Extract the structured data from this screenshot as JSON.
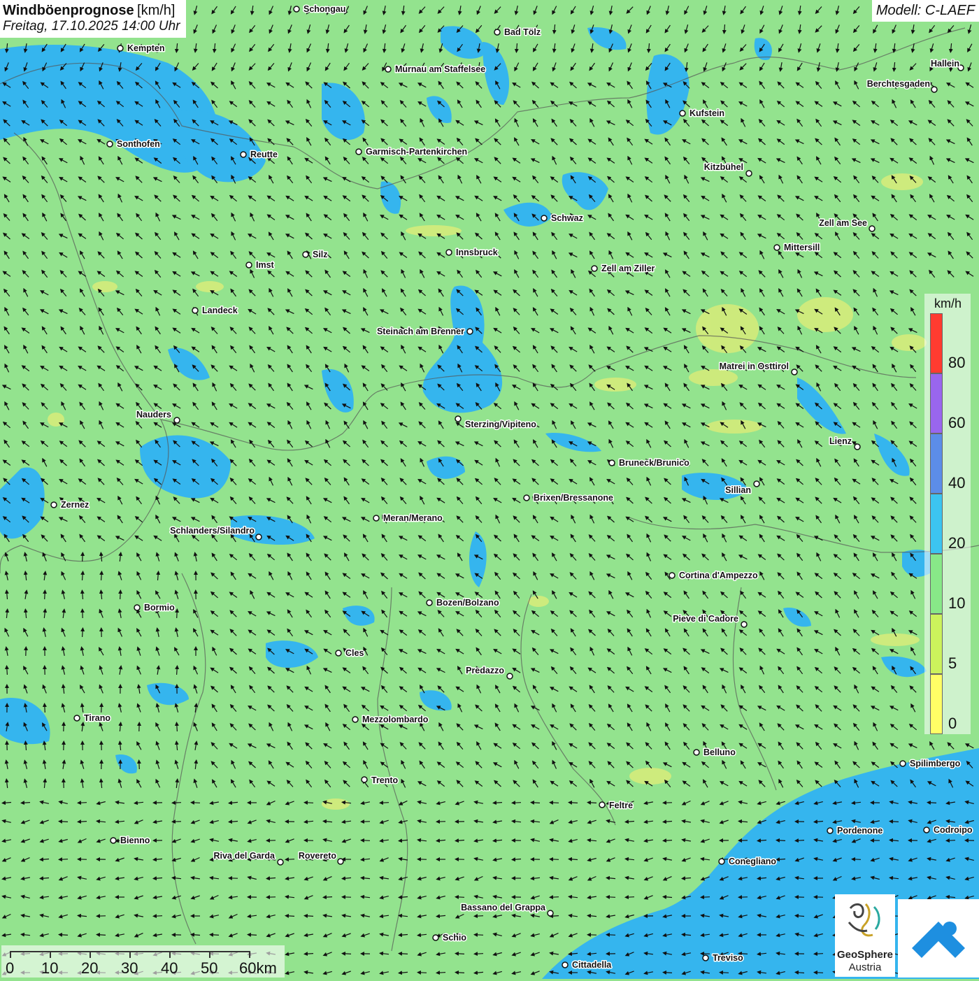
{
  "header": {
    "title": "Windböenprognose",
    "unit": "[km/h]",
    "datetime": "Freitag, 17.10.2025 14:00 Uhr",
    "model": "Modell: C-LAEF"
  },
  "legend": {
    "unit": "km/h",
    "levels": [
      "80",
      "60",
      "40",
      "20",
      "10",
      "5",
      "0"
    ],
    "colors": [
      "#ff3b30",
      "#9966ee",
      "#5c8de8",
      "#3cc4f0",
      "#88e888",
      "#ccf25c",
      "#ffff66"
    ]
  },
  "scalebar": {
    "ticks": [
      "0",
      "10",
      "20",
      "30",
      "40",
      "50",
      "60km"
    ]
  },
  "logos": {
    "geosphere_name": "GeoSphere",
    "geosphere_sub": "Austria"
  },
  "colors": {
    "calm_green": "#93e38e",
    "gust_blue": "#35b5ee",
    "light_yellow": "#d8ec7a",
    "sea_blue": "#35b5ee"
  },
  "wind_direction": "predominantly from south-east to north-west",
  "cities": [
    {
      "name": "Schongau"
    },
    {
      "name": "Bad Tölz"
    },
    {
      "name": "Kempten"
    },
    {
      "name": "Hallein"
    },
    {
      "name": "Murnau am Staffelsee"
    },
    {
      "name": "Berchtesgaden"
    },
    {
      "name": "Kufstein"
    },
    {
      "name": "Sonthofen"
    },
    {
      "name": "Reutte"
    },
    {
      "name": "Garmisch-Partenkirchen"
    },
    {
      "name": "Kitzbühel"
    },
    {
      "name": "Schwaz"
    },
    {
      "name": "Zell am See"
    },
    {
      "name": "Mittersill"
    },
    {
      "name": "Innsbruck"
    },
    {
      "name": "Silz"
    },
    {
      "name": "Imst"
    },
    {
      "name": "Zell am Ziller"
    },
    {
      "name": "Landeck"
    },
    {
      "name": "Steinach am Brenner"
    },
    {
      "name": "Matrei in Osttirol"
    },
    {
      "name": "Nauders"
    },
    {
      "name": "Sterzing/Vipiteno"
    },
    {
      "name": "Lienz"
    },
    {
      "name": "Bruneck/Brunico"
    },
    {
      "name": "Sillian"
    },
    {
      "name": "Zernez"
    },
    {
      "name": "Brixen/Bressanone"
    },
    {
      "name": "Meran/Merano"
    },
    {
      "name": "Schlanders/Silandro"
    },
    {
      "name": "Cortina d'Ampezzo"
    },
    {
      "name": "Bozen/Bolzano"
    },
    {
      "name": "Bormio"
    },
    {
      "name": "Pieve di Cadore"
    },
    {
      "name": "Cles"
    },
    {
      "name": "Predazzo"
    },
    {
      "name": "Tirano"
    },
    {
      "name": "Mezzolombardo"
    },
    {
      "name": "Belluno"
    },
    {
      "name": "Spilimbergo"
    },
    {
      "name": "Trento"
    },
    {
      "name": "Feltre"
    },
    {
      "name": "Bienno"
    },
    {
      "name": "Pordenone"
    },
    {
      "name": "Codroipo"
    },
    {
      "name": "Riva del Garda"
    },
    {
      "name": "Rovereto"
    },
    {
      "name": "Conegliano"
    },
    {
      "name": "Bassano del Grappa"
    },
    {
      "name": "Schio"
    },
    {
      "name": "Treviso"
    },
    {
      "name": "Cittadella"
    }
  ]
}
